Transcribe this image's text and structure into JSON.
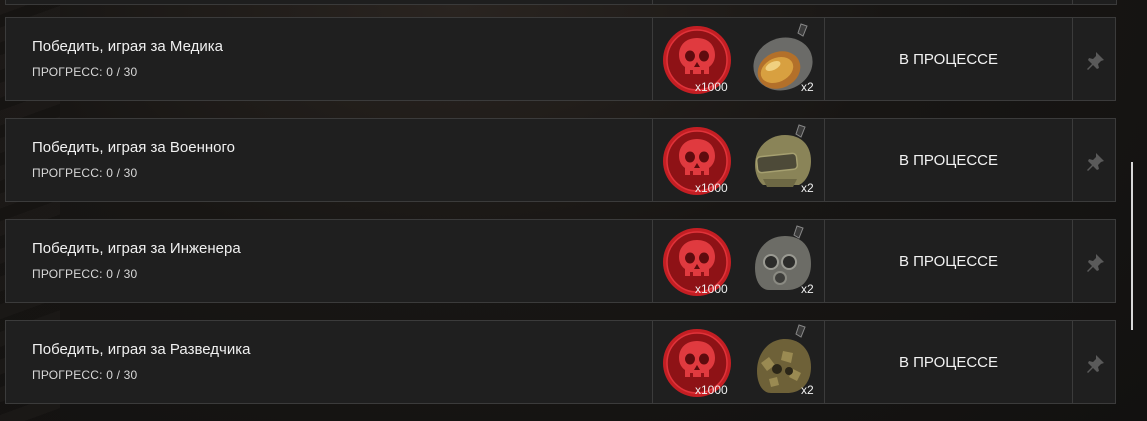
{
  "missions": [
    {
      "title": "Победить, играя за Медика",
      "progress": "ПРОГРЕСС: 0 / 30",
      "reward_skull_qty": "x1000",
      "reward_item_qty": "x2",
      "reward_item_icon": "medic-helmet-icon",
      "status": "В ПРОЦЕССЕ"
    },
    {
      "title": "Победить, играя за Военного",
      "progress": "ПРОГРЕСС: 0 / 30",
      "reward_skull_qty": "x1000",
      "reward_item_qty": "x2",
      "reward_item_icon": "rifleman-helmet-icon",
      "status": "В ПРОЦЕССЕ"
    },
    {
      "title": "Победить, играя за Инженера",
      "progress": "ПРОГРЕСС: 0 / 30",
      "reward_skull_qty": "x1000",
      "reward_item_qty": "x2",
      "reward_item_icon": "engineer-gasmask-helmet-icon",
      "status": "В ПРОЦЕССЕ"
    },
    {
      "title": "Победить, играя за Разведчика",
      "progress": "ПРОГРЕСС: 0 / 30",
      "reward_skull_qty": "x1000",
      "reward_item_qty": "x2",
      "reward_item_icon": "sniper-camo-helmet-icon",
      "status": "В ПРОЦЕССЕ"
    }
  ],
  "icons": {
    "reward_currency": "skull-coin-icon",
    "pin": "pin-icon"
  },
  "colors": {
    "skull_red": "#c41e23",
    "row_bg": "#1f1f1f",
    "row_border": "#3b3b3b"
  }
}
